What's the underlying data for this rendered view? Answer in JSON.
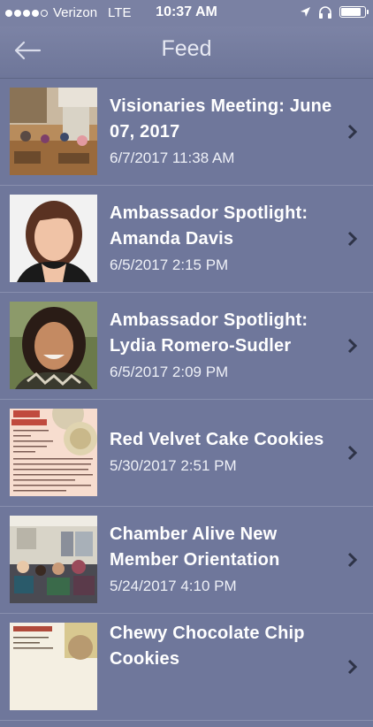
{
  "status_bar": {
    "carrier": "Verizon",
    "network": "LTE",
    "time": "10:37 AM",
    "signal_dots_filled": 4,
    "signal_dots_total": 5,
    "battery_level": 0.85
  },
  "nav": {
    "title": "Feed",
    "back_icon": "arrow-left-icon"
  },
  "feed": {
    "items": [
      {
        "title": "Visionaries Meeting: June 07, 2017",
        "date": "6/7/2017 11:38 AM",
        "thumbnail": "meeting-room-photo"
      },
      {
        "title": "Ambassador Spotlight: Amanda Davis",
        "date": "6/5/2017 2:15 PM",
        "thumbnail": "portrait-photo"
      },
      {
        "title": "Ambassador Spotlight: Lydia Romero-Sudler",
        "date": "6/5/2017 2:09 PM",
        "thumbnail": "portrait-photo"
      },
      {
        "title": "Red Velvet Cake Cookies",
        "date": "5/30/2017 2:51 PM",
        "thumbnail": "recipe-card-image"
      },
      {
        "title": "Chamber Alive New Member Orientation",
        "date": "5/24/2017 4:10 PM",
        "thumbnail": "meeting-room-photo"
      },
      {
        "title": "Chewy Chocolate Chip Cookies",
        "date": "",
        "thumbnail": "recipe-card-image"
      }
    ]
  },
  "colors": {
    "background": "#6f779b",
    "nav_background": "#7a81a3",
    "text": "#ffffff",
    "divider": "#888fae"
  }
}
